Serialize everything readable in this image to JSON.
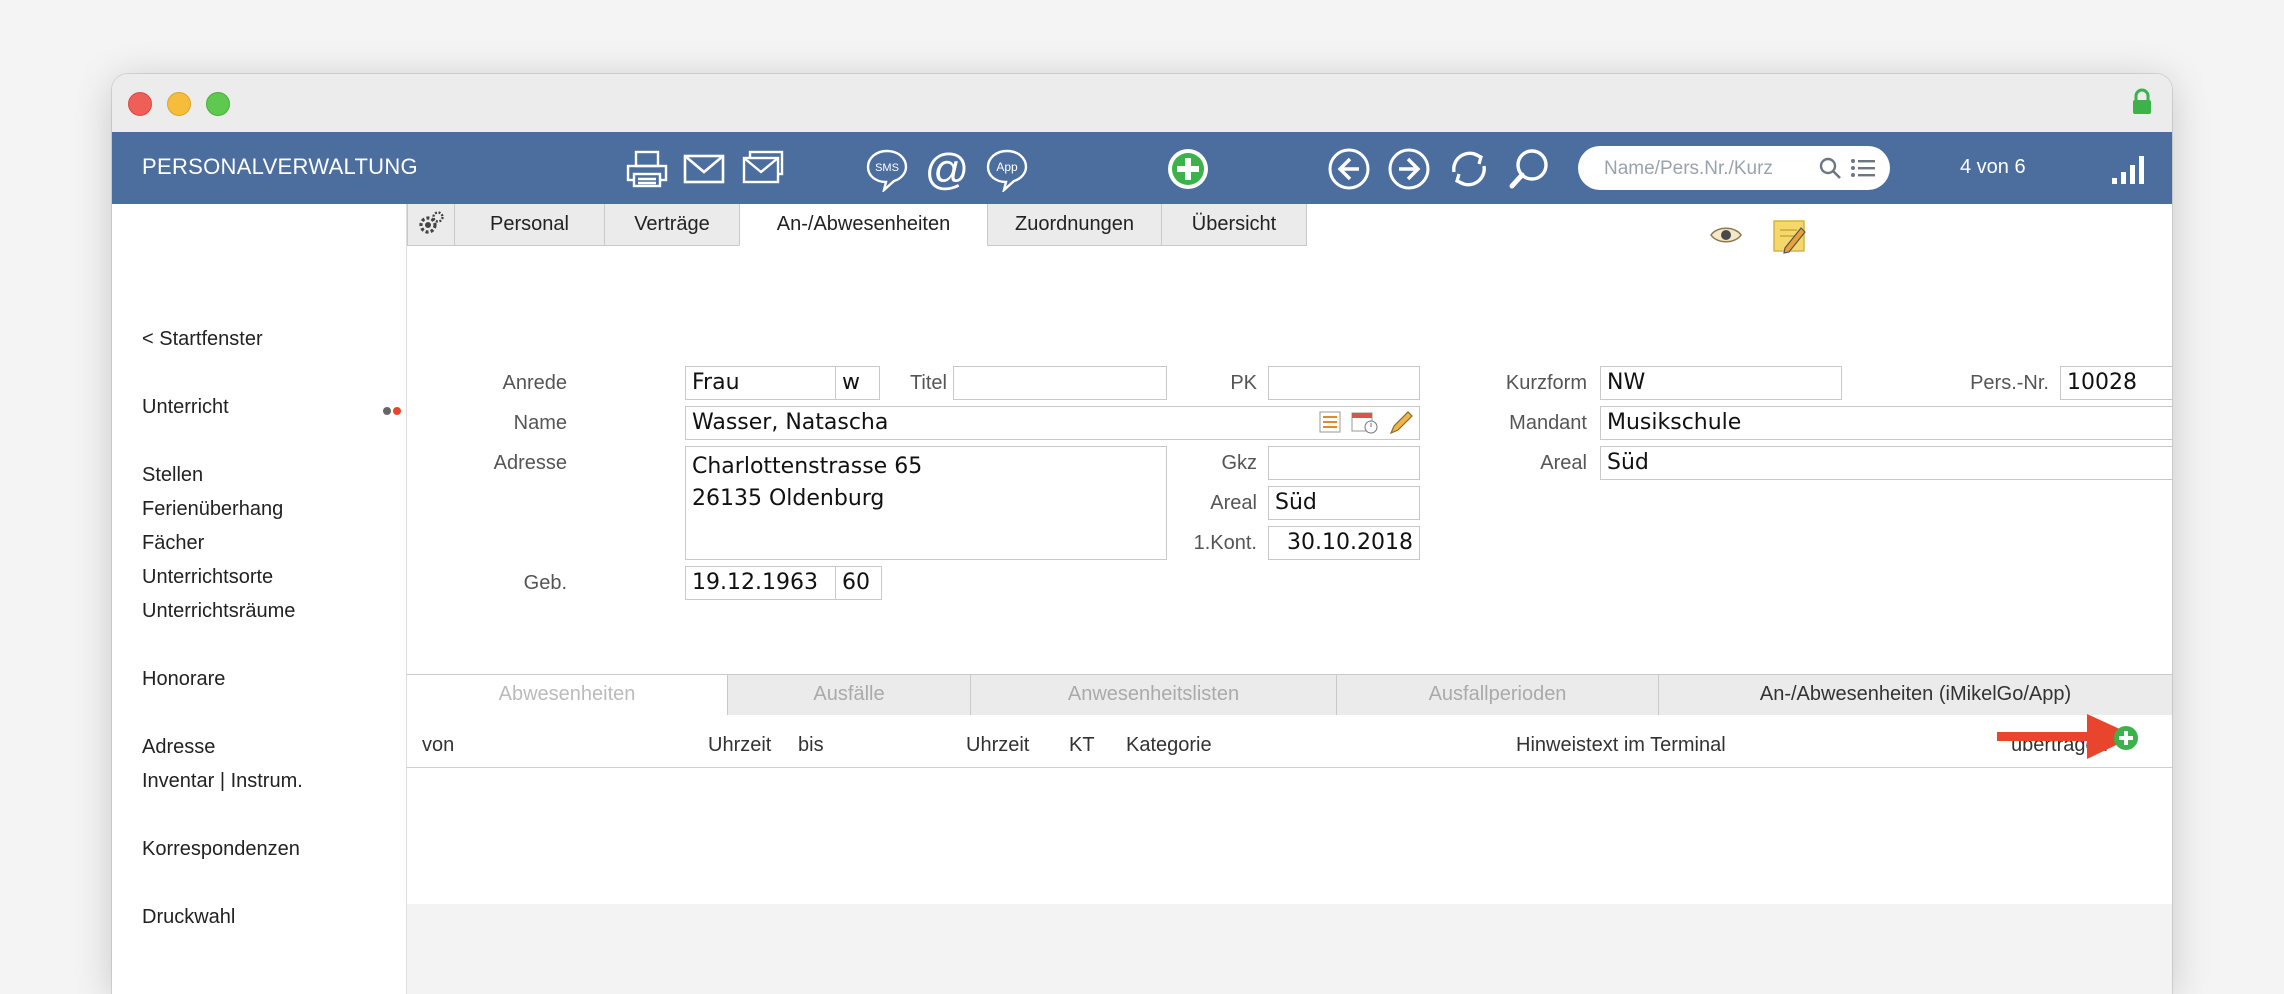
{
  "app": {
    "title": "PERSONALVERWALTUNG",
    "record_count": "4 von 6",
    "search": {
      "placeholder": "Name/Pers.Nr./Kurz"
    }
  },
  "toolbar_icons": [
    "printer-icon",
    "mail-icon",
    "mail-multiple-icon",
    "sms-icon",
    "at-icon",
    "app-icon",
    "add-icon",
    "arrow-left-icon",
    "arrow-right-icon",
    "refresh-icon",
    "search-icon",
    "list-icon",
    "signal-icon"
  ],
  "toolbar_icon_text": {
    "sms": "SMS",
    "at": "@",
    "app": "App"
  },
  "sidebar": {
    "items": [
      "< Startfenster",
      "Unterricht",
      "Stellen",
      "Ferienüberhang",
      "Fächer",
      "Unterrichtsorte",
      "Unterrichtsräume",
      "Honorare",
      "Adresse",
      "Inventar | Instrum.",
      "Korrespondenzen",
      "Druckwahl"
    ]
  },
  "tabs": [
    "Personal",
    "Verträge",
    "An-/Abwesenheiten",
    "Zuordnungen",
    "Übersicht"
  ],
  "active_tab": "An-/Abwesenheiten",
  "form": {
    "labels": {
      "anrede": "Anrede",
      "titel": "Titel",
      "pk": "PK",
      "name": "Name",
      "adresse": "Adresse",
      "gkz": "Gkz",
      "areal": "Areal",
      "kont": "1.Kont.",
      "geb": "Geb.",
      "kurzform": "Kurzform",
      "persnr": "Pers.-Nr.",
      "mandant": "Mandant",
      "areal_right": "Areal"
    },
    "values": {
      "anrede": "Frau",
      "gender": "w",
      "titel": "",
      "pk": "",
      "name": "Wasser, Natascha",
      "address_line1": "Charlottenstrasse 65",
      "address_line2": "26135 Oldenburg",
      "gkz": "",
      "areal": "Süd",
      "kont": "30.10.2018",
      "geb": "19.12.1963",
      "age": "60",
      "kurzform": "NW",
      "persnr": "10028",
      "mandant": "Musikschule",
      "areal_right": "Süd"
    }
  },
  "subtabs": [
    "Abwesenheiten",
    "Ausfälle",
    "Anwesenheitslisten",
    "Ausfallperioden",
    "An-/Abwesenheiten (iMikelGo/App)"
  ],
  "table": {
    "columns": [
      "von",
      "Uhrzeit",
      "bis",
      "Uhrzeit",
      "KT",
      "Kategorie",
      "Hinweistext im Terminal",
      "übertragen"
    ]
  },
  "colors": {
    "toolbar": "#4b6e9e",
    "accent_green": "#3cb34a",
    "arrow_red": "#e8452c"
  }
}
